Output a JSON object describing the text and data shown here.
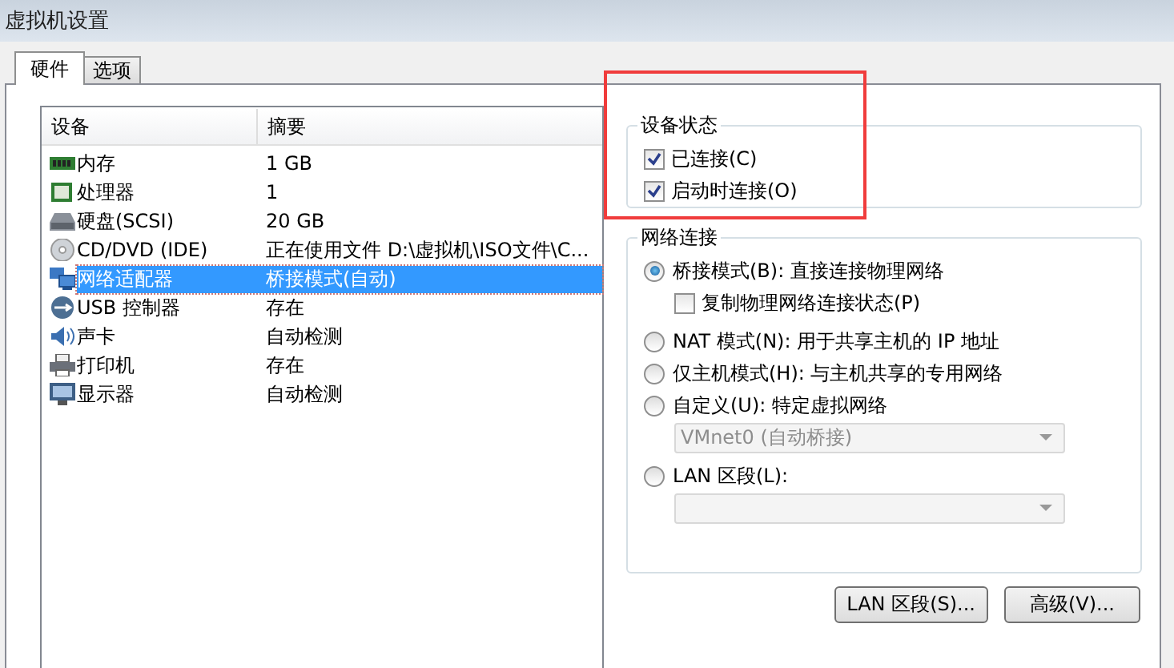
{
  "window": {
    "title": "虚拟机设置"
  },
  "tabs": [
    {
      "label": "硬件",
      "selected": true
    },
    {
      "label": "选项",
      "selected": false
    }
  ],
  "device_list": {
    "columns": [
      "设备",
      "摘要"
    ],
    "rows": [
      {
        "kind": "memory",
        "device": "内存",
        "summary": "1 GB",
        "selected": false
      },
      {
        "kind": "cpu",
        "device": "处理器",
        "summary": "1",
        "selected": false
      },
      {
        "kind": "disk",
        "device": "硬盘(SCSI)",
        "summary": "20 GB",
        "selected": false
      },
      {
        "kind": "cdrom",
        "device": "CD/DVD (IDE)",
        "summary": "正在使用文件 D:\\虚拟机\\ISO文件\\C...",
        "selected": false
      },
      {
        "kind": "network",
        "device": "网络适配器",
        "summary": "桥接模式(自动)",
        "selected": true
      },
      {
        "kind": "usb",
        "device": "USB 控制器",
        "summary": "存在",
        "selected": false
      },
      {
        "kind": "sound",
        "device": "声卡",
        "summary": "自动检测",
        "selected": false
      },
      {
        "kind": "printer",
        "device": "打印机",
        "summary": "存在",
        "selected": false
      },
      {
        "kind": "display",
        "device": "显示器",
        "summary": "自动检测",
        "selected": false
      }
    ]
  },
  "device_status": {
    "title": "设备状态",
    "options": [
      {
        "label": "已连接(C)",
        "checked": true
      },
      {
        "label": "启动时连接(O)",
        "checked": true
      }
    ]
  },
  "network_connection": {
    "title": "网络连接",
    "options": [
      {
        "kind": "radio",
        "label": "桥接模式(B): 直接连接物理网络",
        "selected": true,
        "children": [
          {
            "kind": "checkbox",
            "label": "复制物理网络连接状态(P)",
            "checked": false
          }
        ]
      },
      {
        "kind": "radio",
        "label": "NAT 模式(N): 用于共享主机的 IP 地址",
        "selected": false
      },
      {
        "kind": "radio",
        "label": "仅主机模式(H): 与主机共享的专用网络",
        "selected": false
      },
      {
        "kind": "radio",
        "label": "自定义(U): 特定虚拟网络",
        "selected": false,
        "children": [
          {
            "kind": "dropdown",
            "value": "VMnet0 (自动桥接)",
            "disabled": true
          }
        ]
      },
      {
        "kind": "radio",
        "label": "LAN 区段(L):",
        "selected": false,
        "children": [
          {
            "kind": "dropdown",
            "disabled": true
          }
        ]
      }
    ]
  },
  "buttons": [
    "LAN 区段(S)...",
    "高级(V)..."
  ]
}
